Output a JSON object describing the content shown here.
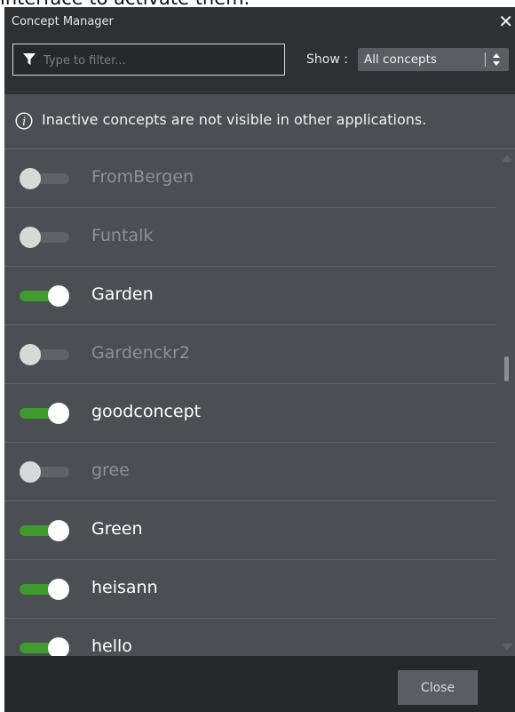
{
  "background_text": "interface to activate them.",
  "dialog": {
    "title": "Concept Manager",
    "close_glyph": "✕",
    "filter": {
      "placeholder": "Type to filter...",
      "value": "",
      "icon": "funnel-icon"
    },
    "show": {
      "label": "Show :",
      "selected": "All concepts"
    },
    "info": {
      "icon": "info-icon",
      "text": "Inactive concepts are not visible in other applications."
    },
    "concepts": [
      {
        "name": "FromBergen",
        "active": false
      },
      {
        "name": "Funtalk",
        "active": false
      },
      {
        "name": "Garden",
        "active": true
      },
      {
        "name": "Gardenckr2",
        "active": false
      },
      {
        "name": "goodconcept",
        "active": true
      },
      {
        "name": "gree",
        "active": false
      },
      {
        "name": "Green",
        "active": true
      },
      {
        "name": "heisann",
        "active": true
      },
      {
        "name": "hello",
        "active": true
      }
    ],
    "footer": {
      "close_label": "Close"
    }
  },
  "colors": {
    "panel_bg": "#4b4e52",
    "header_bg": "#2e3034",
    "footer_bg": "#26282b",
    "toggle_on": "#3e9a2c",
    "toggle_off": "#5f6266",
    "active_text": "#ffffff",
    "inactive_text": "#8e9094"
  }
}
